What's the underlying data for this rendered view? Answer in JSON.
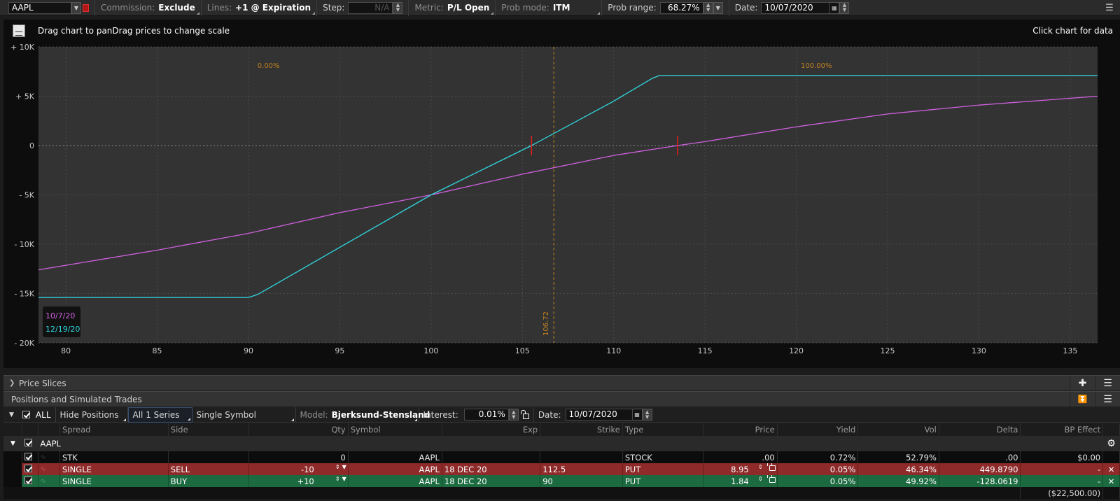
{
  "toolbar": {
    "symbol": "AAPL",
    "commission_label": "Commission:",
    "commission_value": "Exclude",
    "lines_label": "Lines:",
    "lines_value": "+1 @ Expiration",
    "step_label": "Step:",
    "step_value": "N/A",
    "metric_label": "Metric:",
    "metric_value": "P/L Open",
    "prob_mode_label": "Prob mode:",
    "prob_mode_value": "ITM",
    "prob_range_label": "Prob range:",
    "prob_range_value": "68.27%",
    "date_label": "Date:",
    "date_value": "10/07/2020"
  },
  "chart_header": {
    "hint": "Drag chart to panDrag prices to change scale",
    "click_hint": "Click chart for data"
  },
  "chart_data": {
    "type": "line",
    "xlim": [
      78.5,
      136.5
    ],
    "ylim": [
      -20000,
      10000
    ],
    "x_ticks": [
      80,
      85,
      90,
      95,
      100,
      105,
      110,
      115,
      120,
      125,
      130,
      135
    ],
    "y_ticks": [
      {
        "value": 10000,
        "label": "+ 10K"
      },
      {
        "value": 5000,
        "label": "+ 5K"
      },
      {
        "value": 0,
        "label": "0"
      },
      {
        "value": -5000,
        "label": "- 5K"
      },
      {
        "value": -10000,
        "label": "- 10K"
      },
      {
        "value": -15000,
        "label": "- 15K"
      },
      {
        "value": -20000,
        "label": "- 20K"
      }
    ],
    "grid": true,
    "current_price": {
      "x": 106.72,
      "label": "106.72",
      "color": "#c08020"
    },
    "prob_labels": [
      {
        "x": 91.1,
        "text": "0.00%"
      },
      {
        "x": 121.1,
        "text": "100.00%"
      }
    ],
    "breakeven_marks": [
      105.5,
      113.5
    ],
    "series": [
      {
        "name": "10/7/20",
        "color": "#d060e0",
        "x": [
          78.5,
          85,
          90,
          95,
          100,
          105,
          110,
          113.5,
          115,
          120,
          125,
          130,
          136.5
        ],
        "y": [
          -12600,
          -10600,
          -8900,
          -6800,
          -5000,
          -2900,
          -1000,
          0,
          400,
          1900,
          3200,
          4100,
          5000
        ]
      },
      {
        "name": "12/19/20",
        "color": "#30d8e0",
        "x": [
          78.5,
          90,
          90.5,
          100,
          105.5,
          110,
          112.1,
          112.5,
          136.5
        ],
        "y": [
          -15400,
          -15400,
          -15100,
          -5000,
          0,
          4500,
          6800,
          7100,
          7100
        ]
      }
    ],
    "legend": "bottom-left"
  },
  "price_slices": {
    "label": "Price Slices"
  },
  "positions": {
    "label": "Positions and Simulated Trades",
    "all_label": "ALL",
    "hide_positions": "Hide Positions",
    "series_filter": "All 1 Series",
    "symbol_filter": "Single Symbol",
    "model_label": "Model:",
    "model_value": "Bjerksund-Stensland",
    "interest_label": "Interest:",
    "interest_value": "0.01%",
    "date_label": "Date:",
    "date_value": "10/07/2020",
    "columns": [
      "Spread",
      "Side",
      "Qty",
      "Symbol",
      "Exp",
      "Strike",
      "Type",
      "Price",
      "Yield",
      "Vol",
      "Delta",
      "BP Effect"
    ],
    "group": "AAPL",
    "rows": [
      {
        "spread": "STK",
        "side": "",
        "qty": "0",
        "symbol": "AAPL",
        "exp": "",
        "strike": "",
        "type": "STOCK",
        "price": ".00",
        "yield": "0.72%",
        "vol": "52.79%",
        "delta": ".00",
        "bp": "$0.00"
      },
      {
        "spread": "SINGLE",
        "side": "SELL",
        "qty": "-10",
        "symbol": "AAPL",
        "exp": "18 DEC 20",
        "strike": "112.5",
        "type": "PUT",
        "price": "8.95",
        "yield": "0.05%",
        "vol": "46.34%",
        "delta": "449.8790",
        "bp": "-"
      },
      {
        "spread": "SINGLE",
        "side": "BUY",
        "qty": "+10",
        "symbol": "AAPL",
        "exp": "18 DEC 20",
        "strike": "90",
        "type": "PUT",
        "price": "1.84",
        "yield": "0.05%",
        "vol": "49.92%",
        "delta": "-128.0619",
        "bp": "-"
      }
    ],
    "total_bp": "($22,500.00)"
  }
}
